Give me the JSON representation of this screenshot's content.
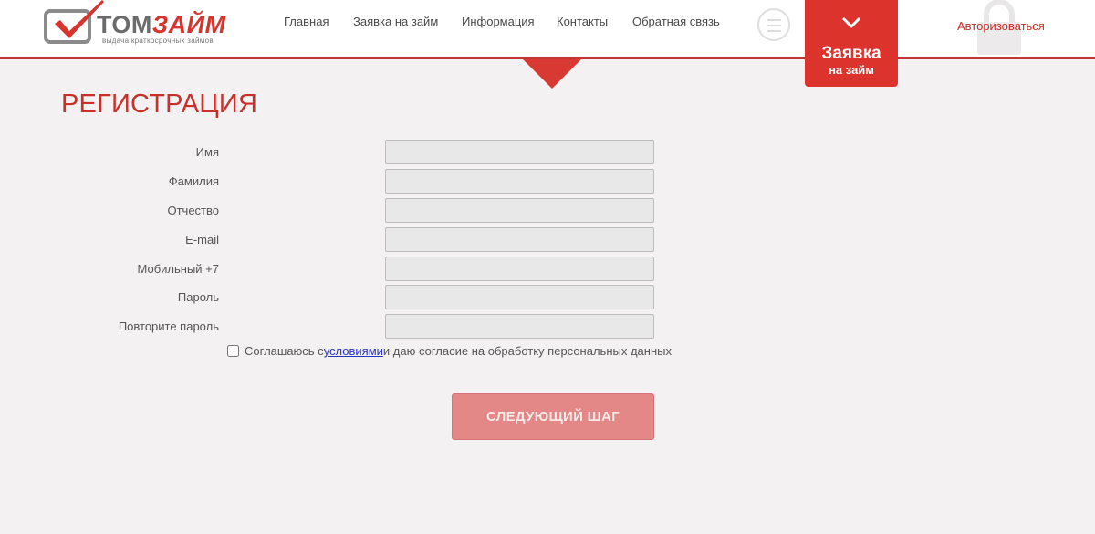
{
  "header": {
    "logo_text_gray": "ТОМ",
    "logo_text_red": "ЗАЙМ",
    "logo_tagline": "выдача краткосрочных займов",
    "nav": [
      "Главная",
      "Заявка на займ",
      "Информация",
      "Контакты",
      "Обратная связь"
    ],
    "apply_line1": "Заявка",
    "apply_line2": "на займ",
    "login": "Авторизоваться"
  },
  "form": {
    "title": "РЕГИСТРАЦИЯ",
    "fields": [
      {
        "label": "Имя",
        "value": ""
      },
      {
        "label": "Фамилия",
        "value": ""
      },
      {
        "label": "Отчество",
        "value": ""
      },
      {
        "label": "E-mail",
        "value": ""
      },
      {
        "label": "Мобильный +7",
        "value": ""
      },
      {
        "label": "Пароль",
        "value": ""
      },
      {
        "label": "Повторите пароль",
        "value": ""
      }
    ],
    "consent_before": "Соглашаюсь с ",
    "consent_link": "условиями ",
    "consent_after": "и даю согласие на обработку персональных данных",
    "consent_checked": false,
    "submit": "СЛЕДУЮЩИЙ ШАГ"
  },
  "colors": {
    "accent": "#dd332d",
    "page_bg": "#f3f1f1",
    "button_bg": "#e48787"
  }
}
